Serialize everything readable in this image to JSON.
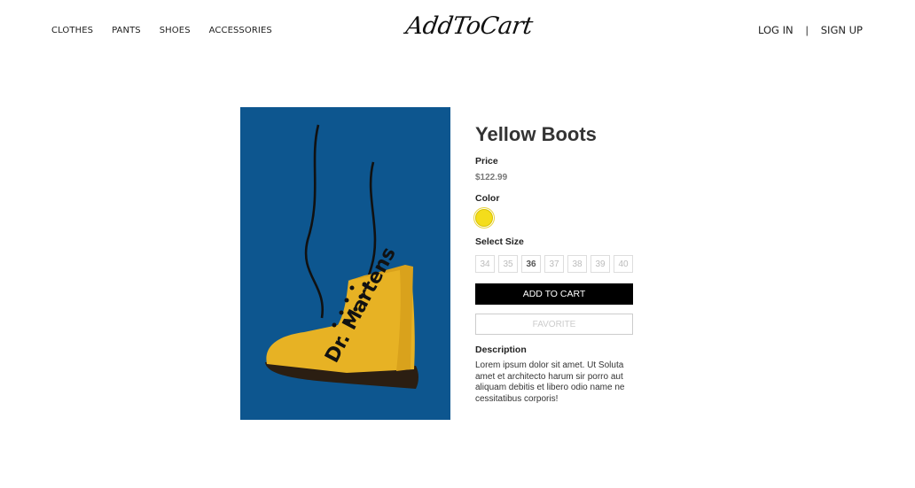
{
  "header": {
    "nav": [
      "CLOTHES",
      "PANTS",
      "SHOES",
      "ACCESSORIES"
    ],
    "logo": "AddToCart",
    "login": "LOG IN",
    "separator": "|",
    "signup": "SIGN UP"
  },
  "product": {
    "title": "Yellow Boots",
    "price_label": "Price",
    "price": "$122.99",
    "color_label": "Color",
    "selected_color": "#f4dd1b",
    "size_label": "Select Size",
    "sizes": [
      "34",
      "35",
      "36",
      "37",
      "38",
      "39",
      "40"
    ],
    "selected_size": "36",
    "add_to_cart": "ADD TO CART",
    "favorite": "FAVORITE",
    "description_label": "Description",
    "description": "Lorem ipsum dolor sit amet. Ut Soluta amet et architecto harum sir porro aut aliquam debitis et libero odio name ne cessitatibus corporis!",
    "image_brand_text": "Dr. Martens"
  },
  "colors": {
    "image_background": "#0d568f",
    "boot": "#e7b224",
    "button": "#000000"
  }
}
